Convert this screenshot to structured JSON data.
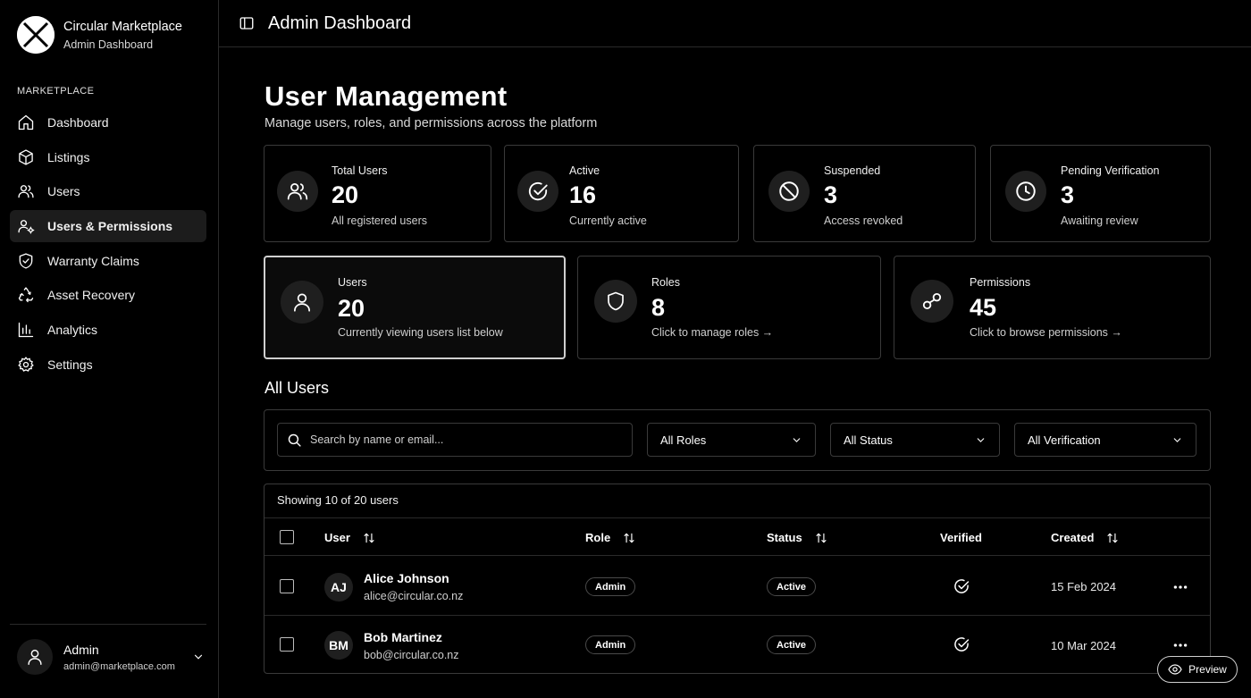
{
  "sidebar": {
    "brand_title": "Circular Marketplace",
    "brand_subtitle": "Admin Dashboard",
    "section_label": "MARKETPLACE",
    "items": [
      {
        "label": "Dashboard",
        "icon": "home-icon"
      },
      {
        "label": "Listings",
        "icon": "box-icon"
      },
      {
        "label": "Users",
        "icon": "users-icon"
      },
      {
        "label": "Users & Permissions",
        "icon": "user-cog-icon",
        "active": true
      },
      {
        "label": "Warranty Claims",
        "icon": "shield-icon"
      },
      {
        "label": "Asset Recovery",
        "icon": "recycle-icon"
      },
      {
        "label": "Analytics",
        "icon": "bar-chart-icon"
      },
      {
        "label": "Settings",
        "icon": "gear-icon"
      }
    ],
    "account": {
      "name": "Admin",
      "email": "admin@marketplace.com"
    }
  },
  "topbar": {
    "title": "Admin Dashboard"
  },
  "page": {
    "title": "User Management",
    "subtitle": "Manage users, roles, and permissions across the platform"
  },
  "stats": [
    {
      "label": "Total Users",
      "value": "20",
      "desc": "All registered users",
      "icon": "users-icon"
    },
    {
      "label": "Active",
      "value": "16",
      "desc": "Currently active",
      "icon": "check-circle-icon"
    },
    {
      "label": "Suspended",
      "value": "3",
      "desc": "Access revoked",
      "icon": "ban-icon"
    },
    {
      "label": "Pending Verification",
      "value": "3",
      "desc": "Awaiting review",
      "icon": "clock-icon"
    }
  ],
  "nav_cards": [
    {
      "label": "Users",
      "value": "20",
      "desc": "Currently viewing users list below",
      "icon": "user-icon"
    },
    {
      "label": "Roles",
      "value": "8",
      "desc": "Click to manage roles →",
      "icon": "shield-icon"
    },
    {
      "label": "Permissions",
      "value": "45",
      "desc": "Click to browse permissions →",
      "icon": "key-icon"
    }
  ],
  "all_users": {
    "heading": "All Users",
    "search_placeholder": "Search by name or email...",
    "filters": {
      "roles": "All Roles",
      "status": "All Status",
      "verification": "All Verification"
    },
    "showing": "Showing 10 of 20 users",
    "columns": {
      "user": "User",
      "role": "Role",
      "status": "Status",
      "verified": "Verified",
      "created": "Created"
    },
    "rows": [
      {
        "initials": "AJ",
        "name": "Alice Johnson",
        "email": "alice@circular.co.nz",
        "role": "Admin",
        "status": "Active",
        "verified": true,
        "created": "15 Feb 2024"
      },
      {
        "initials": "BM",
        "name": "Bob Martinez",
        "email": "bob@circular.co.nz",
        "role": "Admin",
        "status": "Active",
        "verified": true,
        "created": "10 Mar 2024"
      }
    ]
  },
  "preview_label": "Preview"
}
